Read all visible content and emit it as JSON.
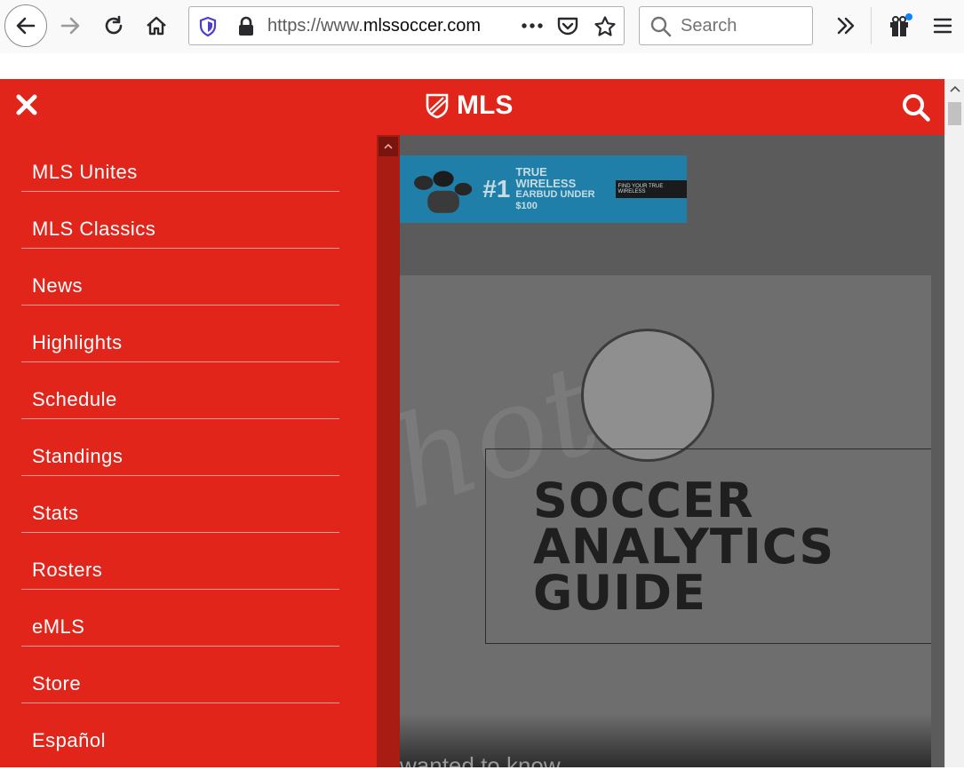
{
  "browser": {
    "url_prefix": "https://www.",
    "url_domain": "mlssoccer.com",
    "search_placeholder": "Search"
  },
  "site": {
    "logo_text": "MLS",
    "brand_color": "#e1251b"
  },
  "menu": {
    "items": [
      {
        "label": "MLS Unites"
      },
      {
        "label": "MLS Classics"
      },
      {
        "label": "News"
      },
      {
        "label": "Highlights"
      },
      {
        "label": "Schedule"
      },
      {
        "label": "Standings"
      },
      {
        "label": "Stats"
      },
      {
        "label": "Rosters"
      },
      {
        "label": "eMLS"
      },
      {
        "label": "Store"
      },
      {
        "label": "Español"
      }
    ]
  },
  "ad": {
    "headline": "#1",
    "line1": "TRUE WIRELESS",
    "line2": "EARBUD UNDER $100",
    "cta": "FIND YOUR TRUE WIRELESS"
  },
  "hero": {
    "title_line1": "SOCCER",
    "title_line2": "ANALYTICS",
    "title_line3": "GUIDE",
    "script_text": "hots",
    "caption": "wanted to know"
  }
}
